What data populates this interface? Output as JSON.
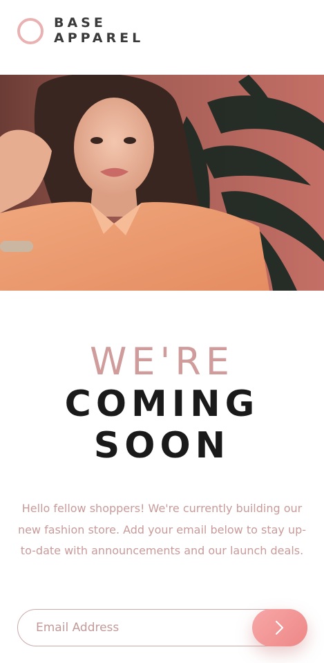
{
  "brand": {
    "line1": "BASE",
    "line2": "APPAREL",
    "logo_color": "#e9b1b1"
  },
  "hero": {
    "image_icon": "hero-photo-woman-orange-shirt"
  },
  "headline": {
    "light": "WE'RE",
    "bold_line1": "COMING",
    "bold_line2": "SOON"
  },
  "intro": {
    "text": "Hello fellow shoppers! We're currently building our new fashion store. Add your email below to stay up-to-date with announcements and our launch deals."
  },
  "form": {
    "email_placeholder": "Email Address",
    "email_value": "",
    "submit_icon": "chevron-right-icon"
  },
  "colors": {
    "accent": "#ee8787",
    "headline_light": "#cf9b9b",
    "text_muted": "#c99a9a",
    "dark": "#1a1a1a"
  }
}
